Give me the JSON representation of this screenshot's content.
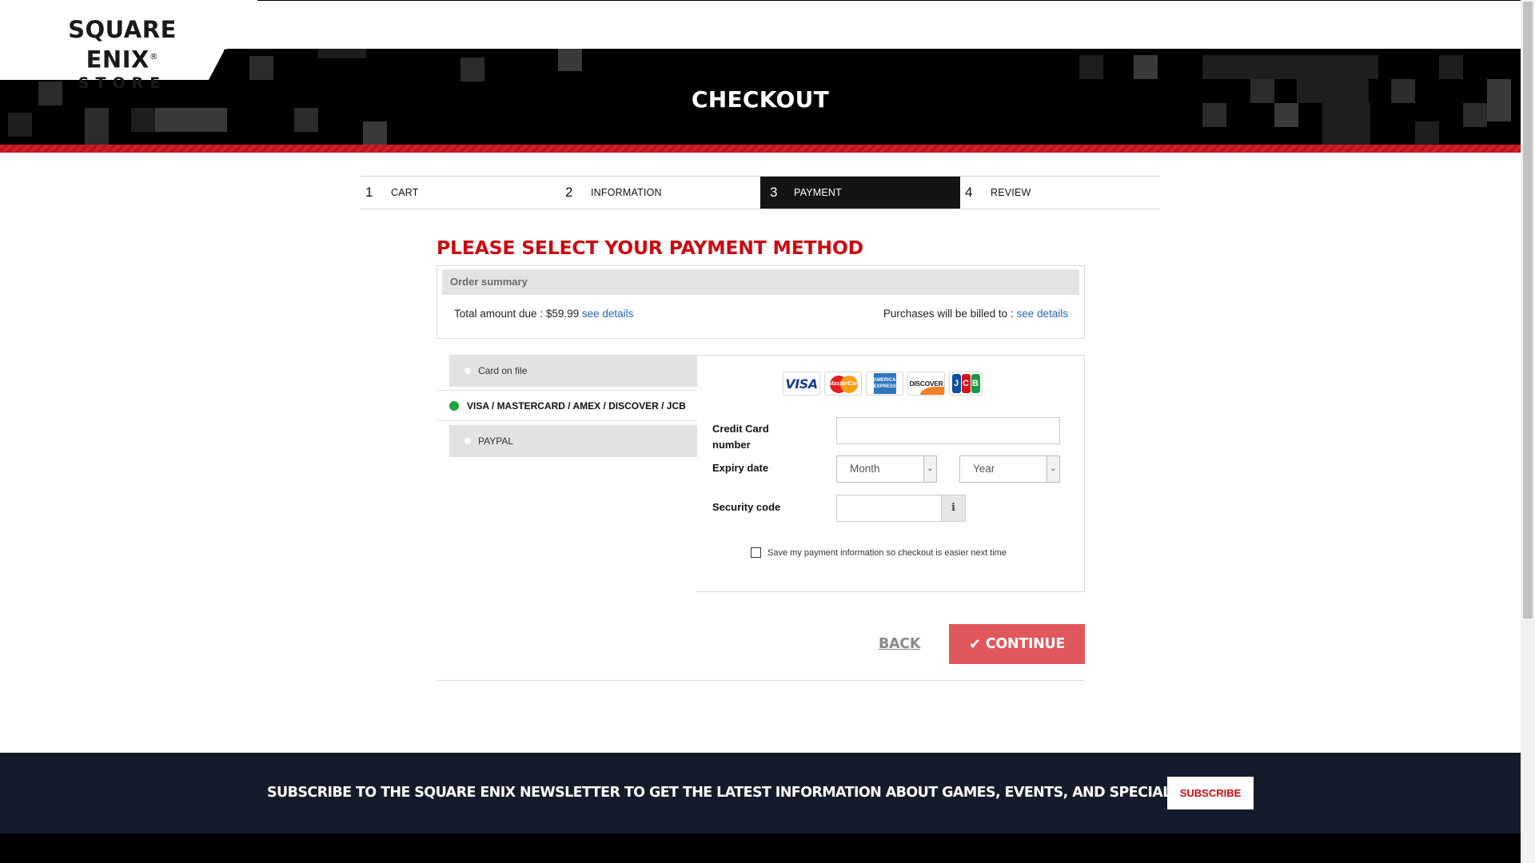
{
  "brand": {
    "logo_line1": "SQUARE ENIX",
    "logo_mark": "®",
    "logo_line2": "STORE"
  },
  "page_title": "CHECKOUT",
  "steps": [
    {
      "num": "1",
      "label": "CART"
    },
    {
      "num": "2",
      "label": "INFORMATION"
    },
    {
      "num": "3",
      "label": "PAYMENT",
      "active": true
    },
    {
      "num": "4",
      "label": "REVIEW"
    }
  ],
  "heading": "PLEASE SELECT YOUR PAYMENT METHOD",
  "summary": {
    "title": "Order summary",
    "total_label": "Total amount due : $59.99",
    "total_link": "see details",
    "billed_label": "Purchases will be billed to :",
    "billed_link": "see details"
  },
  "methods": {
    "card_on_file": "Card on file",
    "cards": "VISA / MASTERCARD / AMEX / DISCOVER / JCB",
    "paypal": "PAYPAL"
  },
  "card_logos": {
    "visa": "VISA",
    "mastercard": "MasterCard",
    "amex": "AMERICAN EXPRESS",
    "discover": "DISCOVER",
    "jcb": [
      "J",
      "C",
      "B"
    ]
  },
  "form": {
    "cc_label": "Credit Card number",
    "cc_value": "",
    "expiry_label": "Expiry date",
    "month_value": "Month",
    "year_value": "Year",
    "security_label": "Security code",
    "security_value": "",
    "info_glyph": "i",
    "save_label": "Save my payment information so checkout is easier next time",
    "save_checked": false
  },
  "actions": {
    "back": "BACK",
    "continue": "CONTINUE"
  },
  "newsletter": {
    "text": "SUBSCRIBE TO THE SQUARE ENIX NEWSLETTER TO GET THE LATEST INFORMATION ABOUT GAMES, EVENTS, AND SPECIAL OFFERS",
    "button": "SUBSCRIBE"
  },
  "colors": {
    "brand_red": "#cc0a12",
    "continue_bg": "#e0575c",
    "selected_dot": "#1fa33a",
    "link": "#2b66b5",
    "footer_bg": "#141c2b"
  }
}
